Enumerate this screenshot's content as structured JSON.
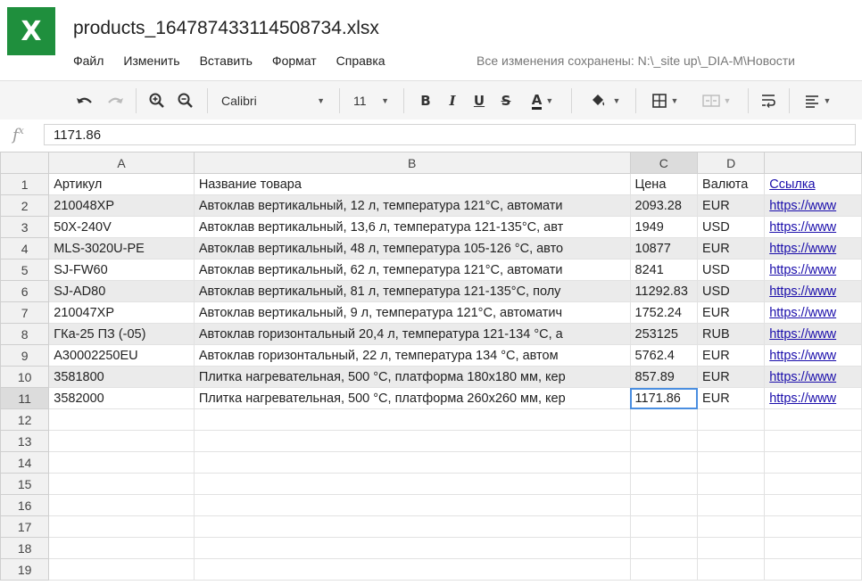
{
  "app": {
    "icon_letter": "X",
    "accent_color": "#1f8f3d"
  },
  "document": {
    "title": "products_164787433114508734.xlsx"
  },
  "menu": {
    "items": [
      "Файл",
      "Изменить",
      "Вставить",
      "Формат",
      "Справка"
    ]
  },
  "save_status": "Все изменения сохранены: N:\\_site up\\_DIA-M\\Новости",
  "toolbar": {
    "font_name": "Calibri",
    "font_size": "11",
    "bold": "B",
    "italic": "I",
    "underline": "U",
    "strike": "S",
    "font_color_letter": "A"
  },
  "formula": {
    "fx_label": "fx",
    "value": "1171.86"
  },
  "columns": [
    "A",
    "B",
    "C",
    "D",
    ""
  ],
  "rows": [
    {
      "n": "1",
      "a": "Артикул",
      "b": "Название товара",
      "c": "Цена",
      "d": "Валюта",
      "e": "Ссылка"
    },
    {
      "n": "2",
      "a": "210048XP",
      "b": "Автоклав вертикальный, 12 л, температура 121°C, автомати",
      "c": "2093.28",
      "d": "EUR",
      "e": "https://www"
    },
    {
      "n": "3",
      "a": "50X-240V",
      "b": "Автоклав вертикальный, 13,6 л, температура 121-135°C, авт",
      "c": "1949",
      "d": "USD",
      "e": "https://www"
    },
    {
      "n": "4",
      "a": "MLS-3020U-PE",
      "b": "Автоклав вертикальный, 48 л, температура 105-126 °C, авто",
      "c": "10877",
      "d": "EUR",
      "e": "https://www"
    },
    {
      "n": "5",
      "a": "SJ-FW60",
      "b": "Автоклав вертикальный, 62 л, температура 121°C, автомати",
      "c": "8241",
      "d": "USD",
      "e": "https://www"
    },
    {
      "n": "6",
      "a": "SJ-AD80",
      "b": "Автоклав вертикальный, 81 л, температура 121-135°C, полу",
      "c": "11292.83",
      "d": "USD",
      "e": "https://www"
    },
    {
      "n": "7",
      "a": "210047XP",
      "b": "Автоклав вертикальный, 9 л, температура 121°C, автоматич",
      "c": "1752.24",
      "d": "EUR",
      "e": "https://www"
    },
    {
      "n": "8",
      "a": "ГКа-25 ПЗ (-05)",
      "b": "Автоклав горизонтальный 20,4 л, температура 121-134 °C, а",
      "c": "253125",
      "d": "RUB",
      "e": "https://www"
    },
    {
      "n": "9",
      "a": "А30002250EU",
      "b": "Автоклав горизонтальный, 22 л, температура 134 °C, автом",
      "c": "5762.4",
      "d": "EUR",
      "e": "https://www"
    },
    {
      "n": "10",
      "a": "3581800",
      "b": "Плитка нагревательная, 500 °C, платформа 180x180 мм, кер",
      "c": "857.89",
      "d": "EUR",
      "e": "https://www"
    },
    {
      "n": "11",
      "a": "3582000",
      "b": "Плитка нагревательная, 500 °C, платформа 260x260 мм, кер",
      "c": "1171.86",
      "d": "EUR",
      "e": "https://www"
    },
    {
      "n": "12",
      "a": "",
      "b": "",
      "c": "",
      "d": "",
      "e": ""
    },
    {
      "n": "13",
      "a": "",
      "b": "",
      "c": "",
      "d": "",
      "e": ""
    },
    {
      "n": "14",
      "a": "",
      "b": "",
      "c": "",
      "d": "",
      "e": ""
    },
    {
      "n": "15",
      "a": "",
      "b": "",
      "c": "",
      "d": "",
      "e": ""
    },
    {
      "n": "16",
      "a": "",
      "b": "",
      "c": "",
      "d": "",
      "e": ""
    },
    {
      "n": "17",
      "a": "",
      "b": "",
      "c": "",
      "d": "",
      "e": ""
    },
    {
      "n": "18",
      "a": "",
      "b": "",
      "c": "",
      "d": "",
      "e": ""
    },
    {
      "n": "19",
      "a": "",
      "b": "",
      "c": "",
      "d": "",
      "e": ""
    }
  ],
  "selection": {
    "cell": "C11",
    "row": "11",
    "column": "C"
  }
}
